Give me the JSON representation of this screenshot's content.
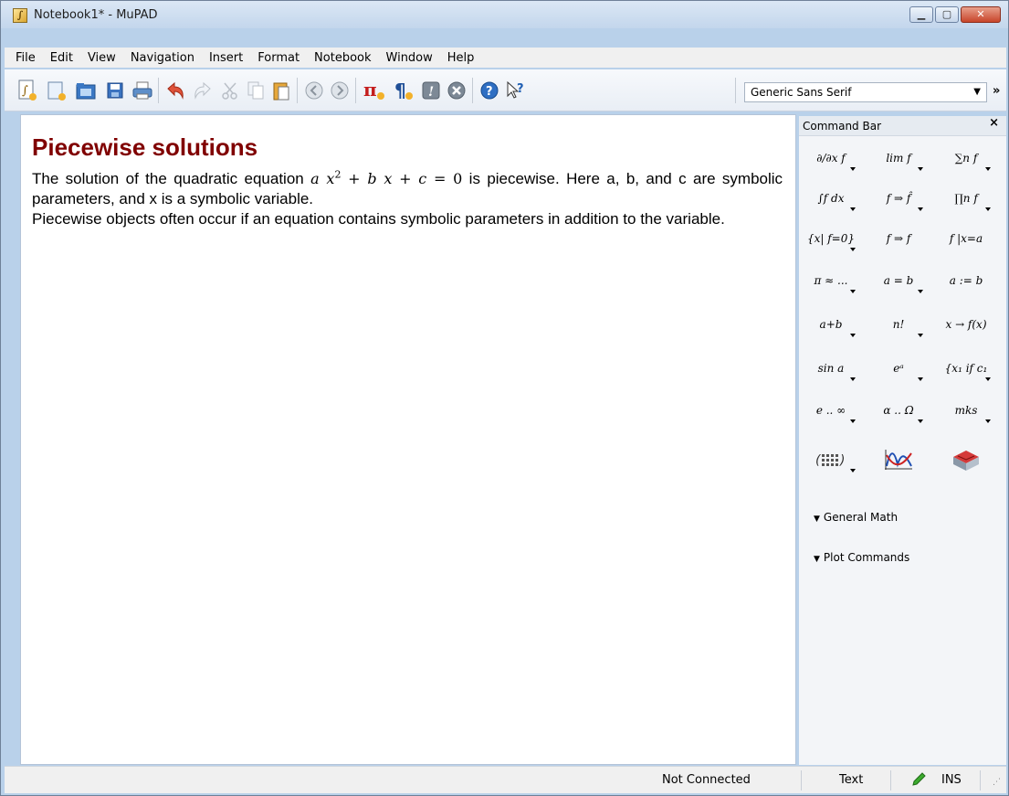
{
  "window": {
    "title": "Notebook1* - MuPAD",
    "minimize_label": "▁",
    "maximize_label": "▢",
    "close_label": "✕"
  },
  "menu": {
    "items": [
      "File",
      "Edit",
      "View",
      "Navigation",
      "Insert",
      "Format",
      "Notebook",
      "Window",
      "Help"
    ]
  },
  "toolbar": {
    "font_select": {
      "value": "Generic Sans Serif"
    },
    "overflow_label": "»"
  },
  "document": {
    "heading": "Piecewise solutions",
    "para1_pre": "The solution of the quadratic equation ",
    "para1_post": " is piecewise. Here a, b, and c are symbolic parameters, and x is a symbolic variable.",
    "equation": {
      "a": "a",
      "x": "x",
      "exp": "2",
      "b": "b",
      "c": "c",
      "zero": "0"
    },
    "para2": "Piecewise objects often occur if an equation contains symbolic parameters in addition to the variable."
  },
  "command_bar": {
    "title": "Command Bar",
    "close_label": "×",
    "cells": [
      "∂/∂x f",
      "lim f",
      "∑n f",
      "∫f dx",
      "f ⇒ f̂",
      "∏n f",
      "{x| f=0}",
      "f ⇒ f",
      "f |x=a",
      "π ≈ ...",
      "a = b",
      "a := b",
      "a+b",
      "n!",
      "x → f(x)",
      "sin a",
      "eᵃ",
      "{x₁ if c₁",
      "e .. ∞",
      "α .. Ω",
      "mks"
    ],
    "sections": [
      "General Math",
      "Plot Commands"
    ]
  },
  "status_bar": {
    "connection": "Not Connected",
    "mode": "Text",
    "insert": "INS"
  },
  "colors": {
    "heading": "#800000",
    "window_frame": "#b9d1ea"
  }
}
